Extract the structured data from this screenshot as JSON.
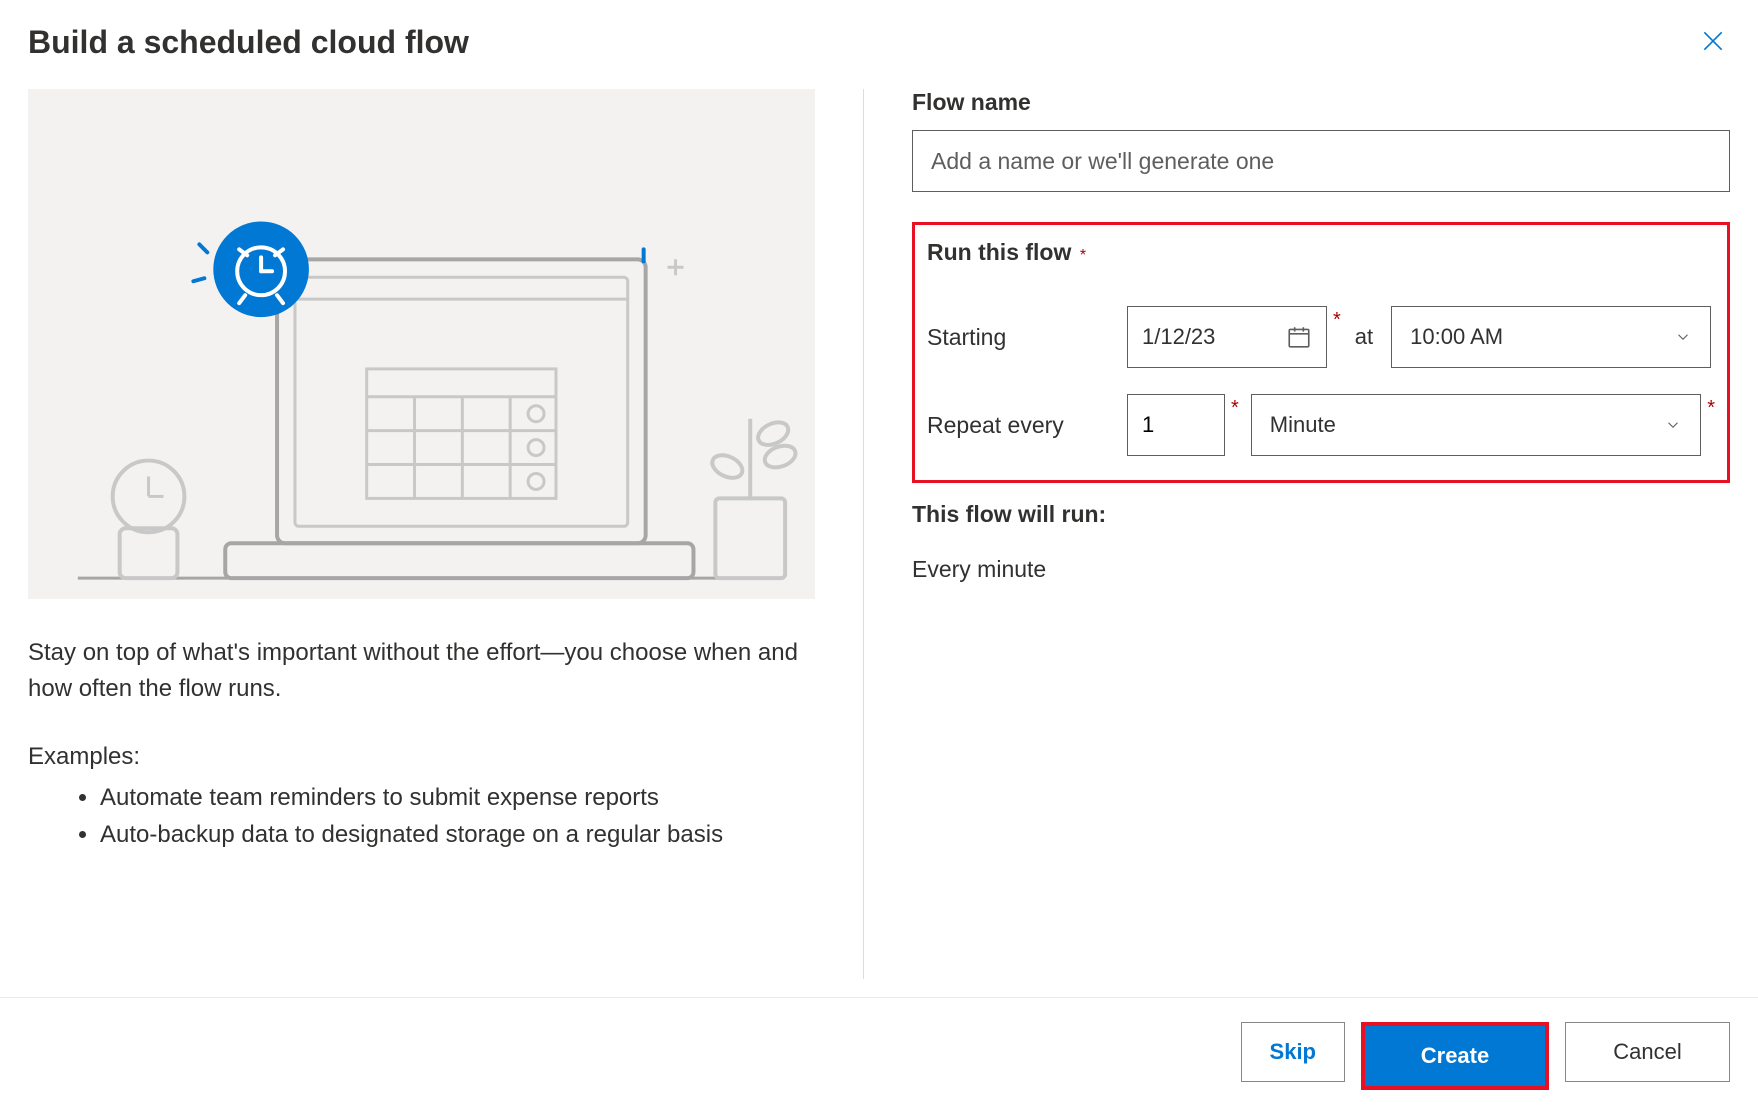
{
  "dialog": {
    "title": "Build a scheduled cloud flow"
  },
  "left": {
    "description": "Stay on top of what's important without the effort—you choose when and how often the flow runs.",
    "examplesLabel": "Examples:",
    "examples": [
      "Automate team reminders to submit expense reports",
      "Auto-backup data to designated storage on a regular basis"
    ]
  },
  "form": {
    "flowNameLabel": "Flow name",
    "flowNamePlaceholder": "Add a name or we'll generate one",
    "flowNameValue": "",
    "runSectionLabel": "Run this flow",
    "startingLabel": "Starting",
    "startingDate": "1/12/23",
    "atLabel": "at",
    "startingTime": "10:00 AM",
    "repeatLabel": "Repeat every",
    "repeatValue": "1",
    "repeatUnit": "Minute",
    "summaryLabel": "This flow will run:",
    "summaryValue": "Every minute"
  },
  "footer": {
    "skip": "Skip",
    "create": "Create",
    "cancel": "Cancel"
  }
}
